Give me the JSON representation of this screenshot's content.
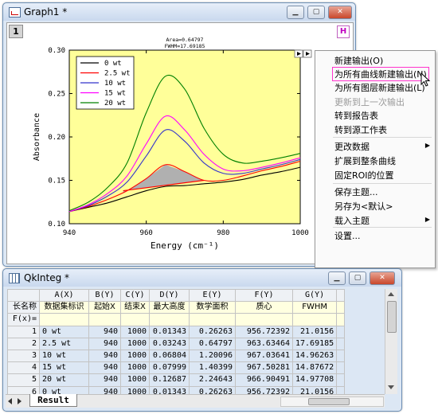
{
  "graph_window": {
    "title": "Graph1 *",
    "layer_number": "1",
    "layer_h": "H",
    "controls": {
      "minimize": "▁",
      "restore": "▢",
      "close": "✕"
    }
  },
  "chart_data": {
    "type": "line",
    "xlabel": "Energy (cm⁻¹)",
    "ylabel": "Absorbance",
    "xlim": [
      940,
      1000
    ],
    "ylim": [
      0.1,
      0.3
    ],
    "xticks": [
      "940",
      "960",
      "980",
      "1000"
    ],
    "yticks": [
      "0.10",
      "0.15",
      "0.20",
      "0.25",
      "0.30"
    ],
    "annotation_area": "Area=0.64797",
    "annotation_fwhm": "FWHM=17.69185",
    "legend_position": "top-left",
    "plot_background": "#ffff99",
    "series": [
      {
        "name": "0 wt",
        "color": "#000000",
        "x": [
          940,
          945,
          950,
          955,
          960,
          965,
          970,
          975,
          980,
          985,
          990,
          995,
          1000
        ],
        "y": [
          0.114,
          0.119,
          0.124,
          0.131,
          0.138,
          0.143,
          0.144,
          0.146,
          0.148,
          0.151,
          0.156,
          0.16,
          0.165
        ]
      },
      {
        "name": "2.5 wt",
        "color": "#ff0000",
        "x": [
          940,
          945,
          950,
          955,
          960,
          965,
          970,
          975,
          980,
          985,
          990,
          995,
          1000
        ],
        "y": [
          0.114,
          0.12,
          0.128,
          0.138,
          0.152,
          0.168,
          0.16,
          0.15,
          0.15,
          0.155,
          0.161,
          0.166,
          0.172
        ]
      },
      {
        "name": "10 wt",
        "color": "#3333cc",
        "x": [
          940,
          945,
          950,
          955,
          960,
          965,
          970,
          975,
          980,
          985,
          990,
          995,
          1000
        ],
        "y": [
          0.114,
          0.121,
          0.132,
          0.148,
          0.178,
          0.208,
          0.195,
          0.17,
          0.158,
          0.158,
          0.163,
          0.168,
          0.174
        ]
      },
      {
        "name": "15 wt",
        "color": "#ff00ff",
        "x": [
          940,
          945,
          950,
          955,
          960,
          965,
          970,
          975,
          980,
          985,
          990,
          995,
          1000
        ],
        "y": [
          0.114,
          0.122,
          0.135,
          0.155,
          0.192,
          0.224,
          0.208,
          0.18,
          0.163,
          0.161,
          0.165,
          0.17,
          0.176
        ]
      },
      {
        "name": "20 wt",
        "color": "#008000",
        "x": [
          940,
          945,
          950,
          955,
          960,
          965,
          970,
          975,
          980,
          985,
          990,
          995,
          1000
        ],
        "y": [
          0.115,
          0.125,
          0.142,
          0.17,
          0.228,
          0.27,
          0.255,
          0.21,
          0.18,
          0.17,
          0.172,
          0.176,
          0.181
        ]
      }
    ],
    "integration_baseline": {
      "x1": 954,
      "y1": 0.138,
      "x2": 975,
      "y2": 0.15
    }
  },
  "context_menu": {
    "items": [
      {
        "label": "新建输出(O)",
        "disabled": false,
        "highlight": false,
        "submenu": false
      },
      {
        "label": "为所有曲线新建输出(N)",
        "disabled": false,
        "highlight": true,
        "submenu": false
      },
      {
        "label": "为所有图层新建输出(L)",
        "disabled": false,
        "highlight": false,
        "submenu": false
      },
      {
        "label": "更新到上一次输出",
        "disabled": true,
        "highlight": false,
        "submenu": false
      },
      {
        "label": "转到报告表",
        "disabled": false,
        "highlight": false,
        "submenu": false
      },
      {
        "label": "转到源工作表",
        "disabled": false,
        "highlight": false,
        "submenu": false
      },
      {
        "label": "更改数据",
        "disabled": false,
        "highlight": false,
        "submenu": true
      },
      {
        "label": "扩展到整条曲线",
        "disabled": false,
        "highlight": false,
        "submenu": false
      },
      {
        "label": "固定ROI的位置",
        "disabled": false,
        "highlight": false,
        "submenu": false
      },
      {
        "label": "保存主题...",
        "disabled": false,
        "highlight": false,
        "submenu": false
      },
      {
        "label": "另存为<默认>",
        "disabled": false,
        "highlight": false,
        "submenu": false
      },
      {
        "label": "载入主题",
        "disabled": false,
        "highlight": false,
        "submenu": true
      },
      {
        "label": "设置...",
        "disabled": false,
        "highlight": false,
        "submenu": false
      }
    ]
  },
  "qk_window": {
    "title": "QkInteg *",
    "sheet_tab": "Result",
    "columns": [
      "A(X)",
      "B(Y)",
      "C(Y)",
      "D(Y)",
      "E(Y)",
      "F(Y)",
      "G(Y)"
    ],
    "long_name_label": "长名称",
    "fx_label": "F(x)=",
    "long_names": [
      "数据集标识",
      "起始X",
      "结束X",
      "最大高度",
      "数学面积",
      "质心",
      "FWHM"
    ],
    "rows": [
      {
        "n": "1",
        "cells": [
          "0 wt",
          "940",
          "1000",
          "0.01343",
          "0.26263",
          "956.72392",
          "21.0156"
        ]
      },
      {
        "n": "2",
        "cells": [
          "2.5 wt",
          "940",
          "1000",
          "0.03243",
          "0.64797",
          "963.63464",
          "17.69185"
        ]
      },
      {
        "n": "3",
        "cells": [
          "10 wt",
          "940",
          "1000",
          "0.06804",
          "1.20096",
          "967.03641",
          "14.96263"
        ]
      },
      {
        "n": "4",
        "cells": [
          "15 wt",
          "940",
          "1000",
          "0.07999",
          "1.40399",
          "967.50281",
          "14.87672"
        ]
      },
      {
        "n": "5",
        "cells": [
          "20 wt",
          "940",
          "1000",
          "0.12687",
          "2.24643",
          "966.90491",
          "14.97708"
        ]
      },
      {
        "n": "6",
        "cells": [
          "0 wt",
          "940",
          "1000",
          "0.01343",
          "0.26263",
          "956.72392",
          "21.0156"
        ]
      }
    ]
  }
}
